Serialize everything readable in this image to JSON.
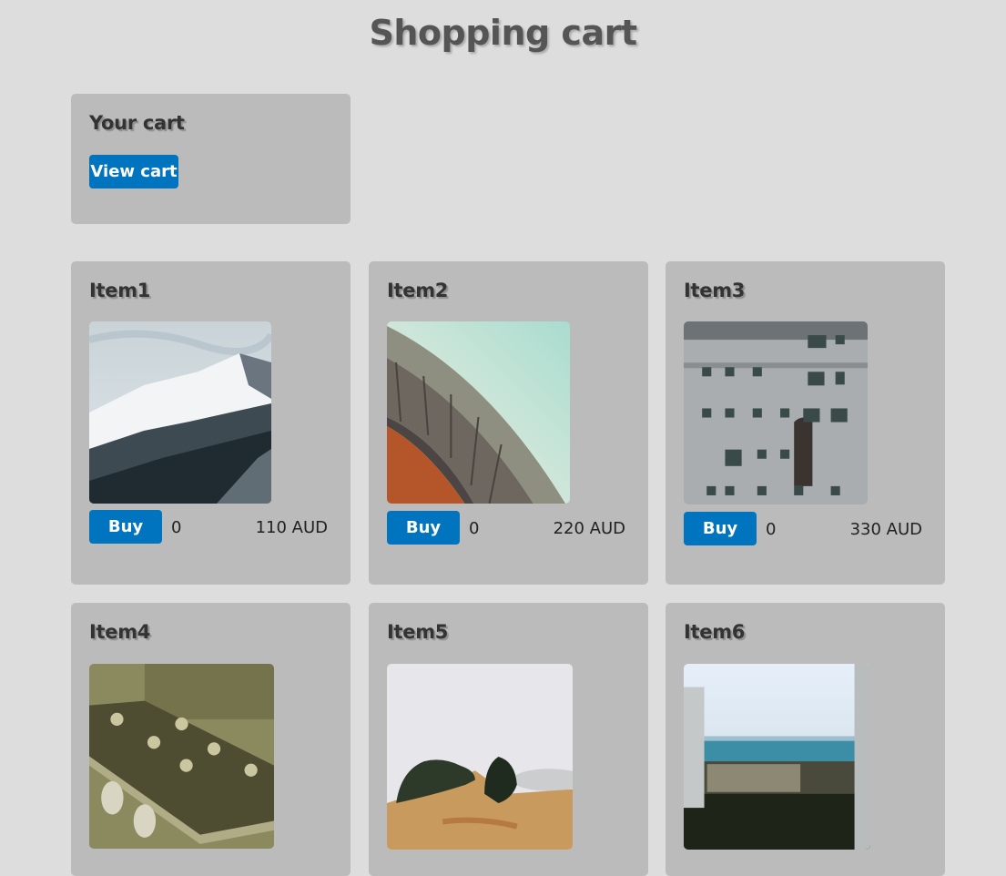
{
  "page": {
    "title": "Shopping cart"
  },
  "cart": {
    "heading": "Your cart",
    "view_cart_label": "View cart"
  },
  "items": [
    {
      "name": "Item1",
      "buy_label": "Buy",
      "quantity": "0",
      "price": "110 AUD",
      "image": "snowy-mountain"
    },
    {
      "name": "Item2",
      "buy_label": "Buy",
      "quantity": "0",
      "price": "220 AUD",
      "image": "curved-building-roof"
    },
    {
      "name": "Item3",
      "buy_label": "Buy",
      "quantity": "0",
      "price": "330 AUD",
      "image": "weathered-apartment-facade"
    },
    {
      "name": "Item4",
      "image": "guitar-headstock"
    },
    {
      "name": "Item5",
      "image": "foggy-hill-with-trees"
    },
    {
      "name": "Item6",
      "image": "coastal-city-view"
    }
  ],
  "colors": {
    "background": "#dddddd",
    "panel": "#bbbbbb",
    "button": "#0074be"
  }
}
